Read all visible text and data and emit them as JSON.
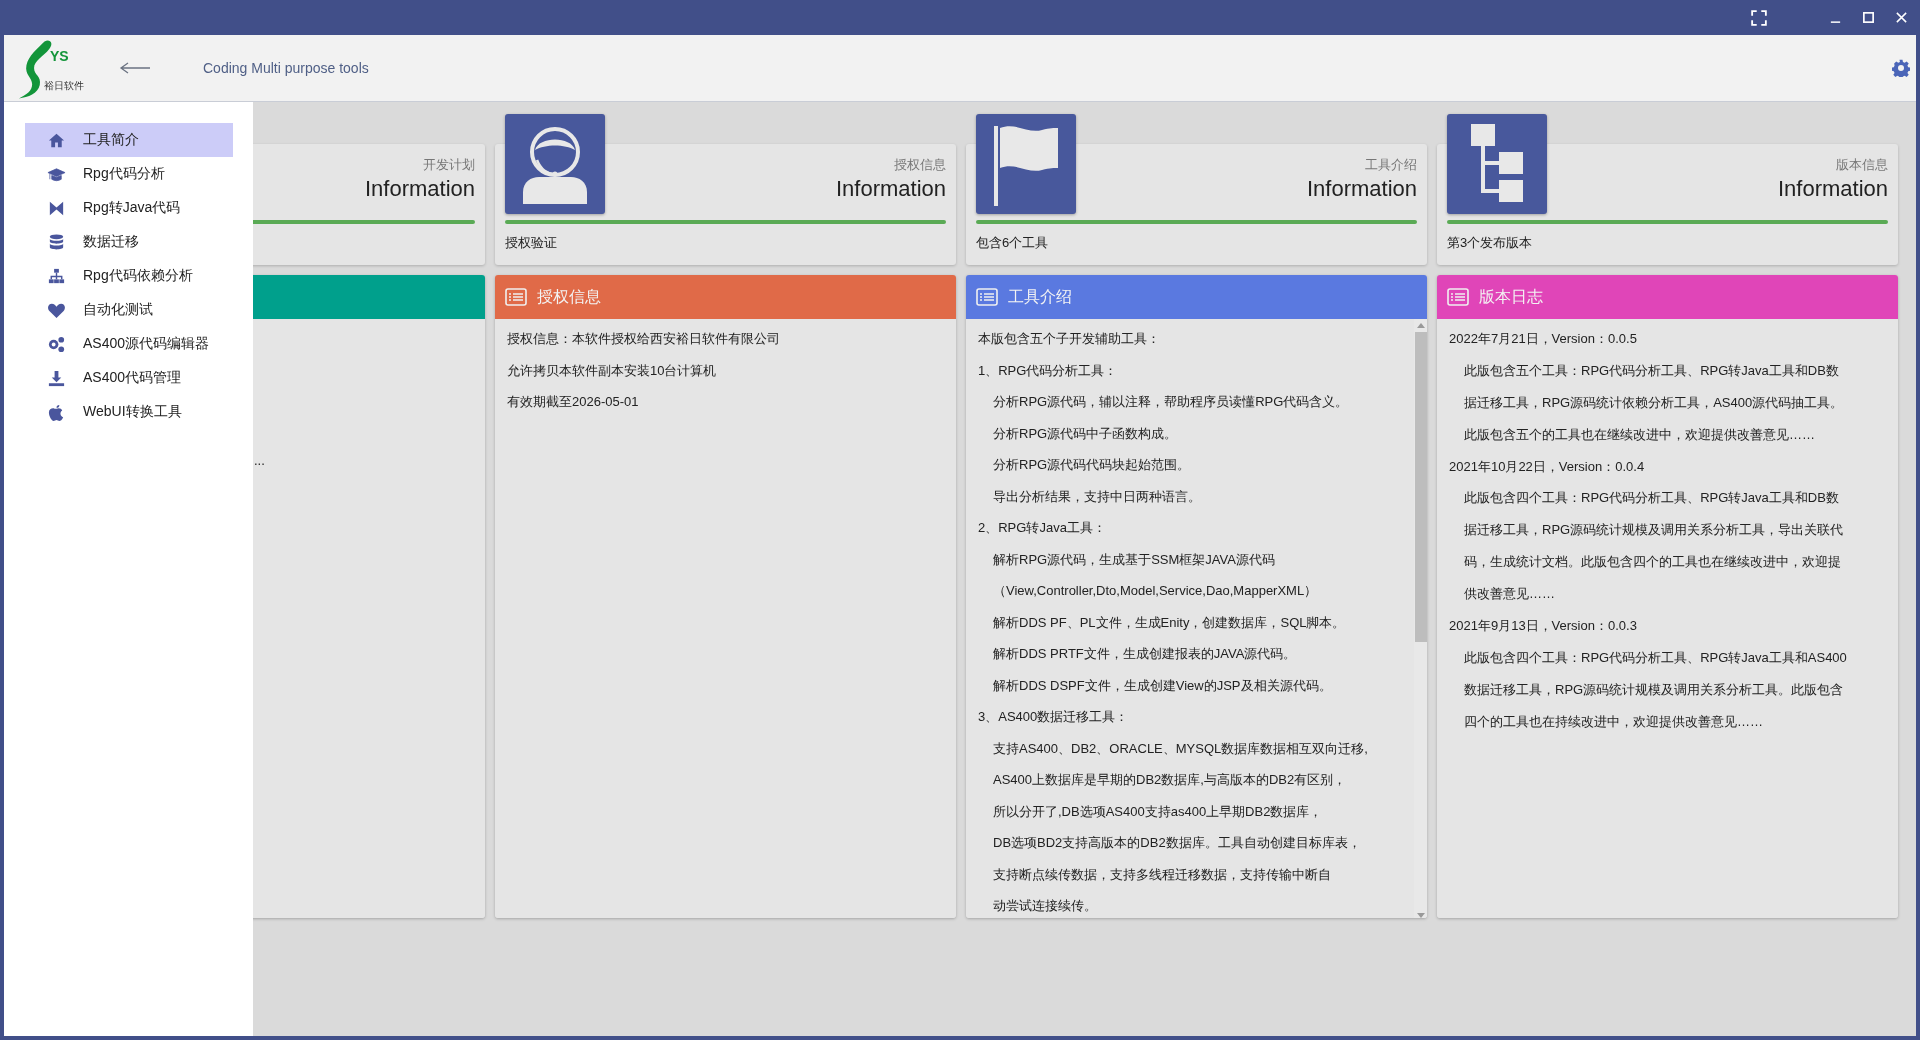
{
  "header": {
    "logo": {
      "mark": "YS",
      "caption": "裕日软件"
    },
    "title": "Coding Multi purpose tools"
  },
  "sidebar": {
    "items": [
      {
        "label": "工具简介",
        "selected": true
      },
      {
        "label": "Rpg代码分析",
        "selected": false
      },
      {
        "label": "Rpg转Java代码",
        "selected": false
      },
      {
        "label": "数据迁移",
        "selected": false
      },
      {
        "label": "Rpg代码依赖分析",
        "selected": false
      },
      {
        "label": "自动化测试",
        "selected": false
      },
      {
        "label": "AS400源代码编辑器",
        "selected": false
      },
      {
        "label": "AS400代码管理",
        "selected": false
      },
      {
        "label": "WebUI转换工具",
        "selected": false
      }
    ]
  },
  "cards": [
    {
      "subtitle": "开发计划",
      "title": "Information"
    },
    {
      "subtitle": "授权信息",
      "title": "Information",
      "footer": "授权验证"
    },
    {
      "subtitle": "工具介绍",
      "title": "Information",
      "footer": "包含6个工具"
    },
    {
      "subtitle": "版本信息",
      "title": "Information",
      "footer": "第3个发布版本"
    }
  ],
  "panels": [
    {
      "color": "#00a08c",
      "lines": [
        {
          "kind": "tail",
          "text": "..."
        }
      ]
    },
    {
      "color": "#e06a48",
      "title": "授权信息",
      "lines": [
        {
          "kind": "text",
          "text": "授权信息：本软件授权给西安裕日软件有限公司"
        },
        {
          "kind": "text",
          "text": "允许拷贝本软件副本安装10台计算机"
        },
        {
          "kind": "text",
          "text": "有效期截至2026-05-01"
        }
      ]
    },
    {
      "color": "#5a79e0",
      "title": "工具介绍",
      "lines": [
        {
          "kind": "text",
          "text": "本版包含五个子开发辅助工具："
        },
        {
          "kind": "text",
          "text": "1、RPG代码分析工具："
        },
        {
          "kind": "indent",
          "text": "分析RPG源代码，辅以注释，帮助程序员读懂RPG代码含义。"
        },
        {
          "kind": "indent",
          "text": "分析RPG源代码中子函数构成。"
        },
        {
          "kind": "indent",
          "text": "分析RPG源代码代码块起始范围。"
        },
        {
          "kind": "indent",
          "text": "导出分析结果，支持中日两种语言。"
        },
        {
          "kind": "text",
          "text": "2、RPG转Java工具："
        },
        {
          "kind": "indent",
          "text": "解析RPG源代码，生成基于SSM框架JAVA源代码"
        },
        {
          "kind": "indent",
          "text": "（View,Controller,Dto,Model,Service,Dao,MapperXML）"
        },
        {
          "kind": "indent",
          "text": "解析DDS PF、PL文件，生成Enity，创建数据库，SQL脚本。"
        },
        {
          "kind": "indent",
          "text": "解析DDS PRTF文件，生成创建报表的JAVA源代码。"
        },
        {
          "kind": "indent",
          "text": "解析DDS DSPF文件，生成创建View的JSP及相关源代码。"
        },
        {
          "kind": "text",
          "text": "3、AS400数据迁移工具："
        },
        {
          "kind": "indent",
          "text": "支持AS400、DB2、ORACLE、MYSQL数据库数据相互双向迁移,"
        },
        {
          "kind": "indent",
          "text": "AS400上数据库是早期的DB2数据库,与高版本的DB2有区别，"
        },
        {
          "kind": "indent",
          "text": "所以分开了,DB选项AS400支持as400上早期DB2数据库，"
        },
        {
          "kind": "indent",
          "text": "DB选项BD2支持高版本的DB2数据库。工具自动创建目标库表，"
        },
        {
          "kind": "indent",
          "text": "支持断点续传数据，支持多线程迁移数据，支持传输中断自"
        },
        {
          "kind": "indent",
          "text": "动尝试连接续传。"
        }
      ]
    },
    {
      "color": "#e045b8",
      "title": "版本日志",
      "lines": [
        {
          "kind": "text",
          "text": "2022年7月21日，Version：0.0.5"
        },
        {
          "kind": "para",
          "text": "此版包含五个工具：RPG代码分析工具、RPG转Java工具和DB数据迁移工具，RPG源码统计依赖分析工具，AS400源代码抽工具。此版包含五个的工具也在继续改进中，欢迎提供改善意见……"
        },
        {
          "kind": "text",
          "text": "2021年10月22日，Version：0.0.4"
        },
        {
          "kind": "para",
          "text": "此版包含四个工具：RPG代码分析工具、RPG转Java工具和DB数据迁移工具，RPG源码统计规模及调用关系分析工具，导出关联代码，生成统计文档。此版包含四个的工具也在继续改进中，欢迎提供改善意见……"
        },
        {
          "kind": "text",
          "text": "2021年9月13日，Version：0.0.3"
        },
        {
          "kind": "para",
          "text": "此版包含四个工具：RPG代码分析工具、RPG转Java工具和AS400数据迁移工具，RPG源码统计规模及调用关系分析工具。此版包含四个的工具也在持续改进中，欢迎提供改善意见……"
        }
      ]
    }
  ]
}
